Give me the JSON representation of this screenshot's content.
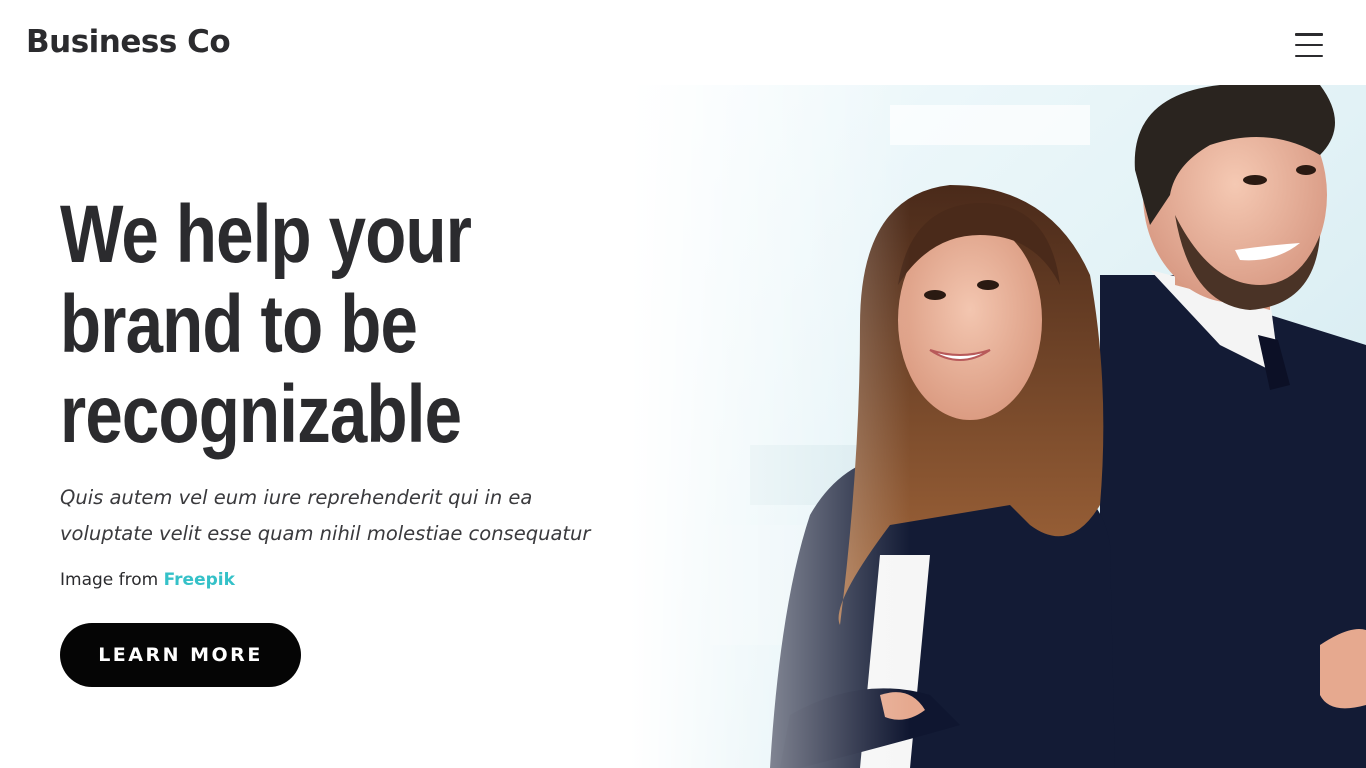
{
  "header": {
    "brand": "Business Co",
    "menu_icon": "hamburger-menu-icon"
  },
  "hero": {
    "headline_lines": [
      "We help your",
      "brand to be",
      "recognizable"
    ],
    "lead": "Quis autem vel eum iure reprehenderit qui in ea voluptate velit esse quam nihil molestiae consequatur",
    "credit_prefix": "Image from",
    "credit_link": "Freepik",
    "cta_label": "LEARN MORE"
  },
  "colors": {
    "text": "#2b2b2e",
    "accent_link": "#35c1c8",
    "button": "#050505",
    "suit": "#131b35"
  }
}
